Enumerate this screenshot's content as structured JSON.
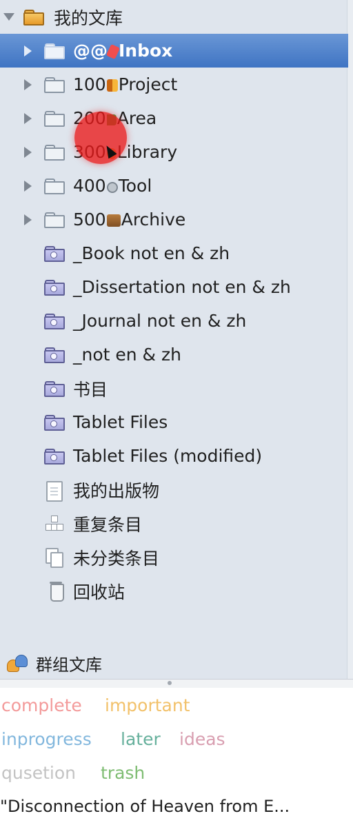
{
  "library": {
    "title": "我的文库",
    "group_title": "群组文库",
    "collections": [
      {
        "label": "@@",
        "suffix": "Inbox",
        "emoji": "pin",
        "selected": true
      },
      {
        "label": "100",
        "suffix": "Project",
        "emoji": "book"
      },
      {
        "label": "200",
        "suffix": "Area",
        "emoji": "flag"
      },
      {
        "label": "300",
        "suffix": "Library",
        "emoji": "target"
      },
      {
        "label": "400",
        "suffix": "Tool",
        "emoji": "magnifier"
      },
      {
        "label": "500",
        "suffix": "Archive",
        "emoji": "box"
      }
    ],
    "saved_searches": [
      "_Book not en & zh",
      "_Dissertation not en & zh",
      "_Journal not en & zh",
      "_not en & zh",
      "书目",
      "Tablet Files",
      "Tablet Files (modified)"
    ],
    "special": [
      {
        "label": "我的出版物",
        "icon": "document-icon"
      },
      {
        "label": "重复条目",
        "icon": "duplicate-icon"
      },
      {
        "label": "未分类条目",
        "icon": "unfiled-icon"
      },
      {
        "label": "回收站",
        "icon": "trash-icon"
      }
    ]
  },
  "tags": [
    {
      "label": "complete",
      "color": "#7fbd73"
    },
    {
      "label": "important",
      "color": "#f39a9a"
    },
    {
      "label": "inprogress",
      "color": "#f2c16a"
    },
    {
      "label": "later",
      "color": "#82b7dd"
    },
    {
      "label": "ideas",
      "color": "#66b09c"
    },
    {
      "label": "qusetion",
      "color": "#d89eb0"
    },
    {
      "label": "trash",
      "color": "#c3c3c3"
    }
  ],
  "footer_item": "\"Disconnection of Heaven from E...",
  "colors": {
    "selection": "#3f74c3",
    "pane_background": "#dfe5ed"
  }
}
